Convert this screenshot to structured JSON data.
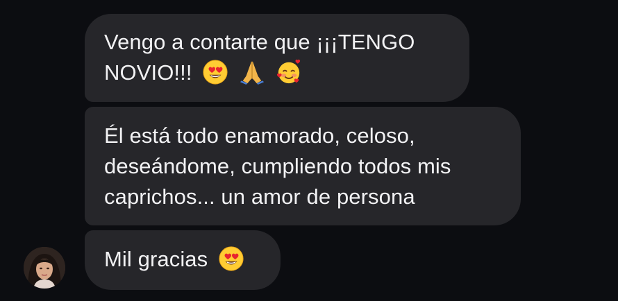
{
  "messages": [
    {
      "lines": [
        "Vengo a contarte que ¡¡¡TENGO",
        "NOVIO!!!"
      ],
      "emojis": [
        "heart-eyes-emoji",
        "folded-hands-emoji",
        "smiling-face-with-hearts-emoji"
      ]
    },
    {
      "lines": [
        "Él está todo enamorado, celoso,",
        "deseándome, cumpliendo todos mis",
        "caprichos... un amor de persona"
      ]
    },
    {
      "lines": [
        "Mil gracias"
      ],
      "emojis": [
        "heart-eyes-emoji"
      ]
    }
  ],
  "colors": {
    "background": "#0c0d11",
    "bubble": "#26262a",
    "text": "#f2f2f4"
  }
}
